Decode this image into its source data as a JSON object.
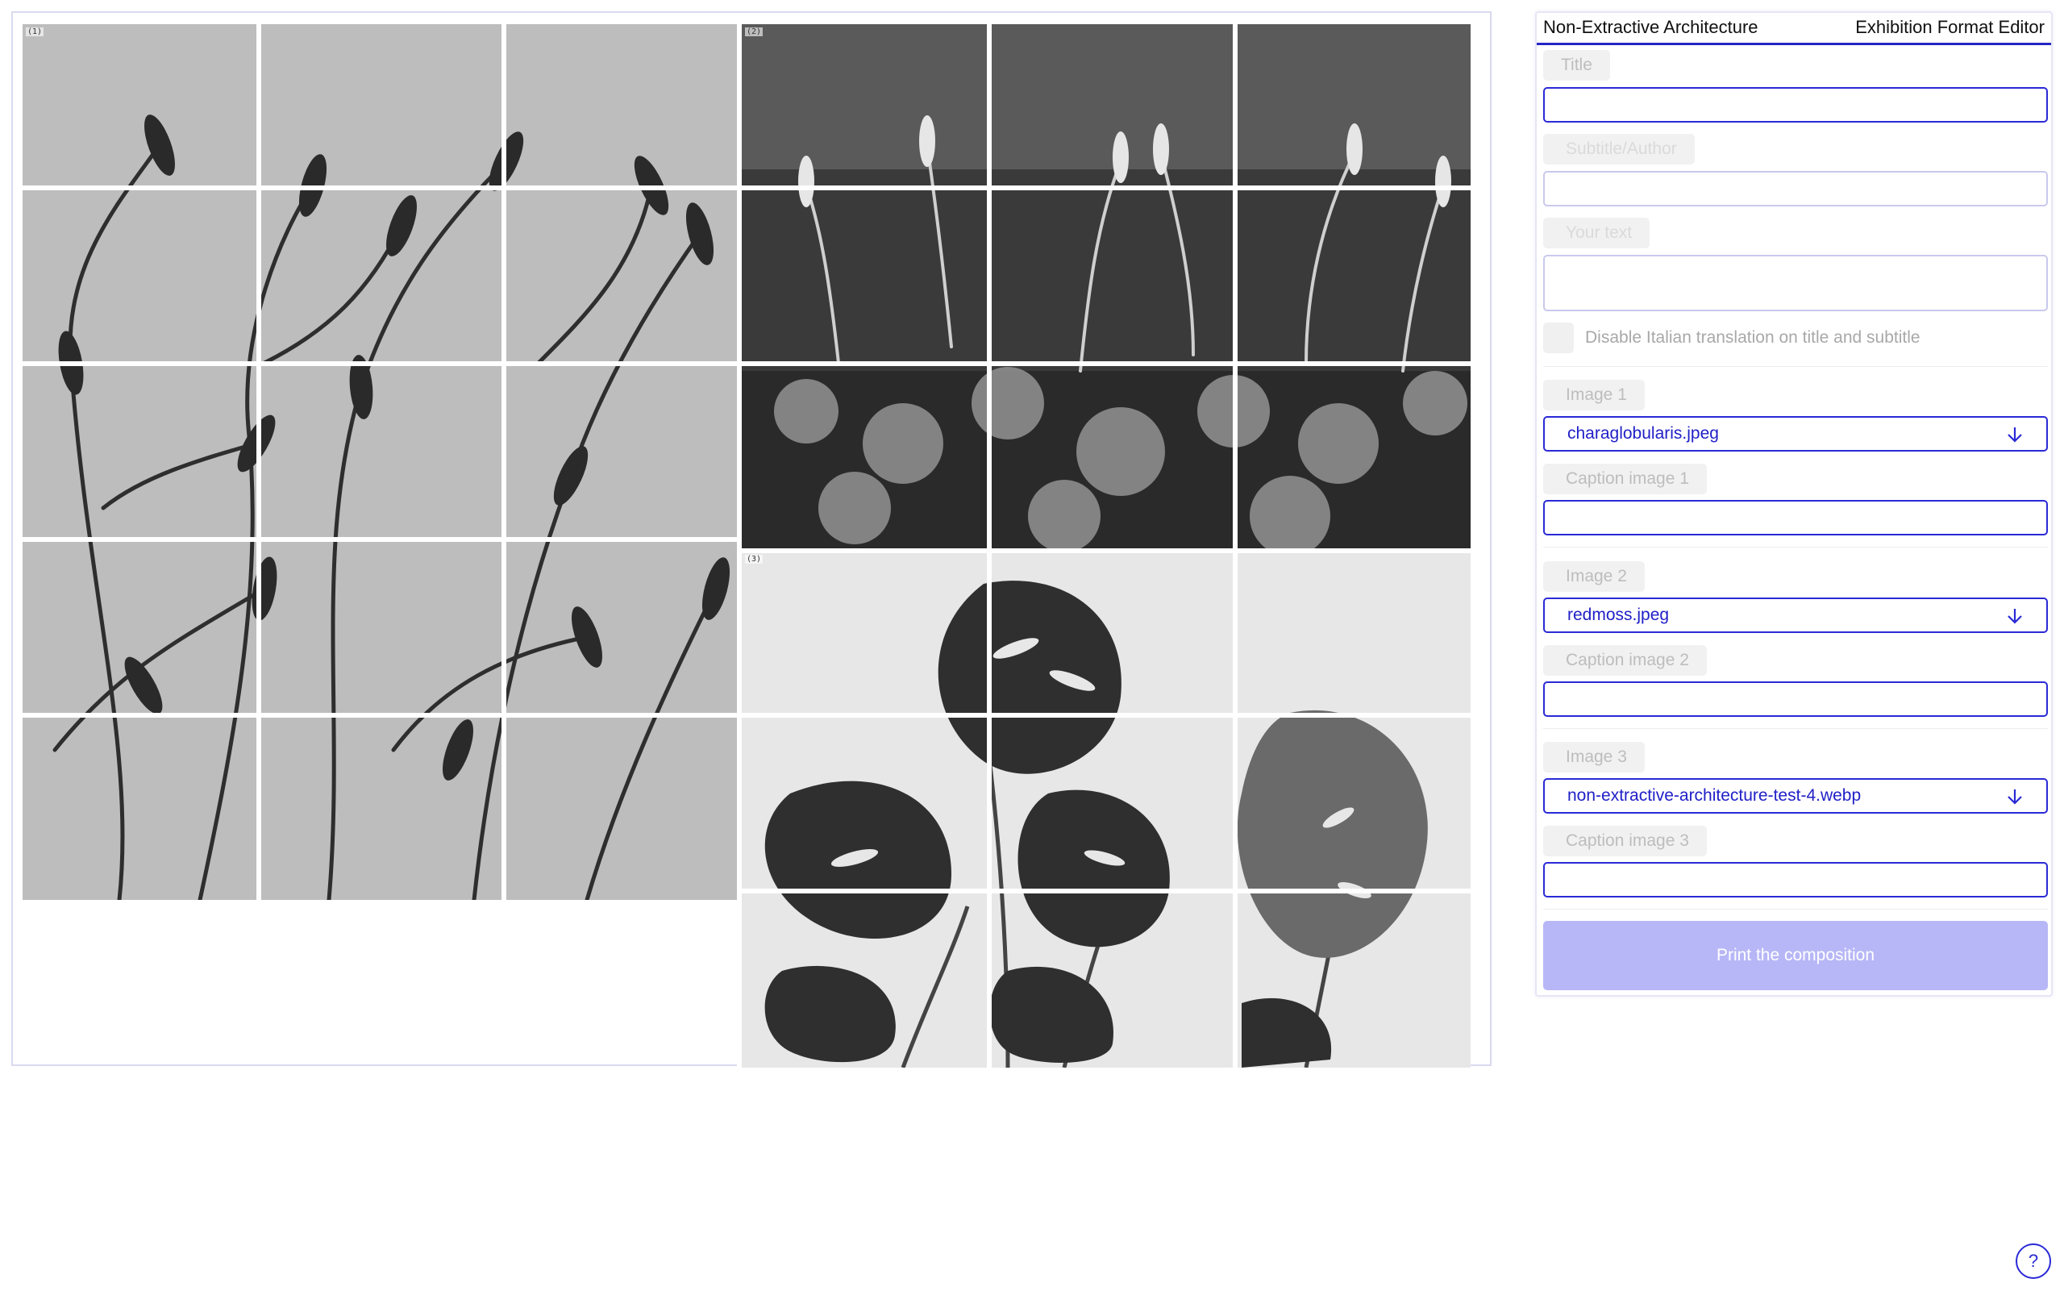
{
  "header": {
    "app_title": "Non-Extractive Architecture",
    "editor_title": "Exhibition Format Editor"
  },
  "preview": {
    "panels": [
      {
        "number": "(1)",
        "image": "charaglobularis.jpeg"
      },
      {
        "number": "(2)",
        "image": "redmoss.jpeg"
      },
      {
        "number": "(3)",
        "image": "non-extractive-architecture-test-4.webp"
      }
    ]
  },
  "form": {
    "title_label": "Title",
    "title_value": "",
    "subtitle_label": "Subtitle/Author",
    "subtitle_value": "",
    "text_label": "Your text",
    "text_value": "",
    "disable_translation_label": "Disable Italian translation on title and subtitle",
    "image1_label": "Image 1",
    "image1_value": "charaglobularis.jpeg",
    "caption1_label": "Caption image 1",
    "image2_label": "Image 2",
    "image2_value": "redmoss.jpeg",
    "caption2_label": "Caption image 2",
    "image3_label": "Image 3",
    "image3_value": "non-extractive-architecture-test-4.webp",
    "caption3_label": "Caption image 3",
    "print_label": "Print the composition"
  },
  "help": {
    "label": "?"
  },
  "icons": {
    "select_arrow": "arrow-down-icon",
    "help": "question-mark-icon"
  },
  "colors": {
    "accent": "#2a2ad6",
    "print_button": "#b7b7f7",
    "label_bg": "#f1f1f1"
  }
}
